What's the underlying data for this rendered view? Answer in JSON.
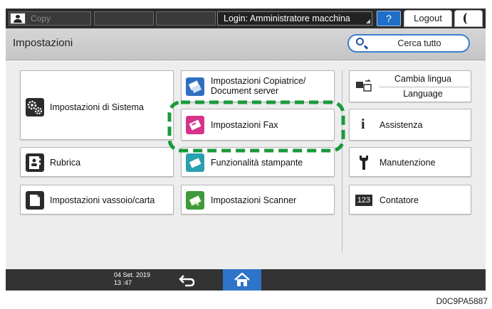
{
  "topbar": {
    "user_text": "Copy",
    "login_label": "Login: Amministratore macchina",
    "help_label": "?",
    "logout_label": "Logout"
  },
  "titlebar": {
    "title": "Impostazioni",
    "search_label": "Cerca tutto"
  },
  "tiles": {
    "system": "Impostazioni di Sistema",
    "copier": "Impostazioni Copiatrice/\nDocument server",
    "fax": "Impostazioni Fax",
    "address_book": "Rubrica",
    "printer": "Funzionalità stampante",
    "tray": "Impostazioni vassoio/carta",
    "scanner": "Impostazioni Scanner",
    "language_1": "Cambia lingua",
    "language_2": "Language",
    "assistance": "Assistenza",
    "maintenance": "Manutenzione",
    "counter": "Contatore",
    "counter_badge": "123"
  },
  "bottombar": {
    "date": "04 Set. 2019",
    "time": "13 :47"
  },
  "footer_code": "D0C9PA5887",
  "colors": {
    "highlight": "#1a9a3a",
    "accent_blue": "#2e74c8",
    "fax_magenta": "#d6338a"
  },
  "icons": {
    "system": "gears-icon",
    "copier": "copier-icon",
    "fax": "fax-icon",
    "address_book": "address-book-icon",
    "printer": "printer-icon",
    "tray": "paper-tray-icon",
    "scanner": "scanner-icon",
    "language": "language-switch-icon",
    "assistance": "info-icon",
    "maintenance": "wrench-icon",
    "counter": "counter-icon",
    "search": "search-icon",
    "back": "back-arrow-icon",
    "home": "home-icon",
    "user": "user-icon",
    "night": "moon-icon"
  }
}
